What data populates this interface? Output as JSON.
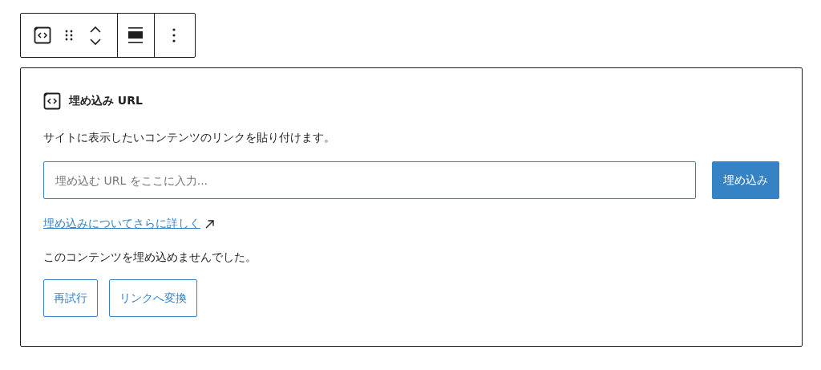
{
  "block": {
    "title": "埋め込み URL",
    "description": "サイトに表示したいコンテンツのリンクを貼り付けます。",
    "url_field": {
      "placeholder": "埋め込む URL をここに入力..."
    },
    "embed_button": "埋め込み",
    "learn_more_link": "埋め込みについてさらに詳しく",
    "error_message": "このコンテンツを埋め込めませんでした。",
    "buttons": [
      "再試行",
      "リンクへ変換"
    ]
  }
}
